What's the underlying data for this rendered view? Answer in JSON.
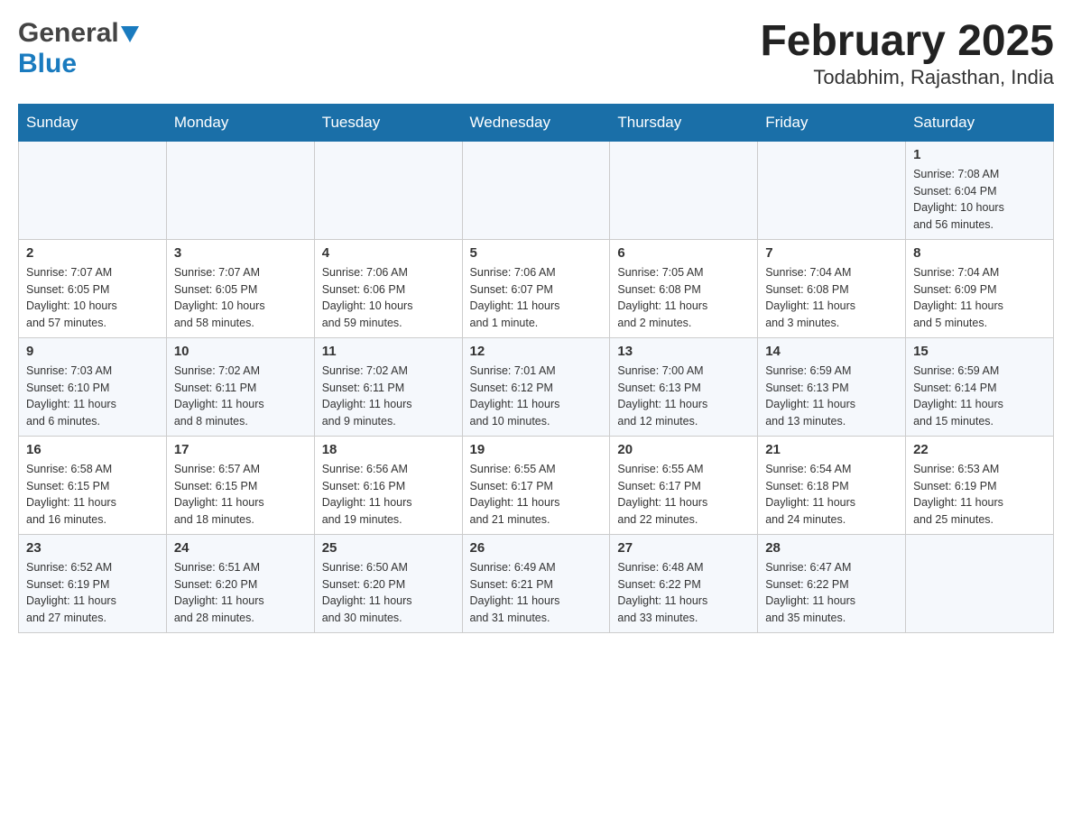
{
  "header": {
    "logo_general": "General",
    "logo_blue": "Blue",
    "title": "February 2025",
    "subtitle": "Todabhim, Rajasthan, India"
  },
  "days_of_week": [
    "Sunday",
    "Monday",
    "Tuesday",
    "Wednesday",
    "Thursday",
    "Friday",
    "Saturday"
  ],
  "weeks": [
    {
      "days": [
        {
          "number": "",
          "info": ""
        },
        {
          "number": "",
          "info": ""
        },
        {
          "number": "",
          "info": ""
        },
        {
          "number": "",
          "info": ""
        },
        {
          "number": "",
          "info": ""
        },
        {
          "number": "",
          "info": ""
        },
        {
          "number": "1",
          "info": "Sunrise: 7:08 AM\nSunset: 6:04 PM\nDaylight: 10 hours\nand 56 minutes."
        }
      ]
    },
    {
      "days": [
        {
          "number": "2",
          "info": "Sunrise: 7:07 AM\nSunset: 6:05 PM\nDaylight: 10 hours\nand 57 minutes."
        },
        {
          "number": "3",
          "info": "Sunrise: 7:07 AM\nSunset: 6:05 PM\nDaylight: 10 hours\nand 58 minutes."
        },
        {
          "number": "4",
          "info": "Sunrise: 7:06 AM\nSunset: 6:06 PM\nDaylight: 10 hours\nand 59 minutes."
        },
        {
          "number": "5",
          "info": "Sunrise: 7:06 AM\nSunset: 6:07 PM\nDaylight: 11 hours\nand 1 minute."
        },
        {
          "number": "6",
          "info": "Sunrise: 7:05 AM\nSunset: 6:08 PM\nDaylight: 11 hours\nand 2 minutes."
        },
        {
          "number": "7",
          "info": "Sunrise: 7:04 AM\nSunset: 6:08 PM\nDaylight: 11 hours\nand 3 minutes."
        },
        {
          "number": "8",
          "info": "Sunrise: 7:04 AM\nSunset: 6:09 PM\nDaylight: 11 hours\nand 5 minutes."
        }
      ]
    },
    {
      "days": [
        {
          "number": "9",
          "info": "Sunrise: 7:03 AM\nSunset: 6:10 PM\nDaylight: 11 hours\nand 6 minutes."
        },
        {
          "number": "10",
          "info": "Sunrise: 7:02 AM\nSunset: 6:11 PM\nDaylight: 11 hours\nand 8 minutes."
        },
        {
          "number": "11",
          "info": "Sunrise: 7:02 AM\nSunset: 6:11 PM\nDaylight: 11 hours\nand 9 minutes."
        },
        {
          "number": "12",
          "info": "Sunrise: 7:01 AM\nSunset: 6:12 PM\nDaylight: 11 hours\nand 10 minutes."
        },
        {
          "number": "13",
          "info": "Sunrise: 7:00 AM\nSunset: 6:13 PM\nDaylight: 11 hours\nand 12 minutes."
        },
        {
          "number": "14",
          "info": "Sunrise: 6:59 AM\nSunset: 6:13 PM\nDaylight: 11 hours\nand 13 minutes."
        },
        {
          "number": "15",
          "info": "Sunrise: 6:59 AM\nSunset: 6:14 PM\nDaylight: 11 hours\nand 15 minutes."
        }
      ]
    },
    {
      "days": [
        {
          "number": "16",
          "info": "Sunrise: 6:58 AM\nSunset: 6:15 PM\nDaylight: 11 hours\nand 16 minutes."
        },
        {
          "number": "17",
          "info": "Sunrise: 6:57 AM\nSunset: 6:15 PM\nDaylight: 11 hours\nand 18 minutes."
        },
        {
          "number": "18",
          "info": "Sunrise: 6:56 AM\nSunset: 6:16 PM\nDaylight: 11 hours\nand 19 minutes."
        },
        {
          "number": "19",
          "info": "Sunrise: 6:55 AM\nSunset: 6:17 PM\nDaylight: 11 hours\nand 21 minutes."
        },
        {
          "number": "20",
          "info": "Sunrise: 6:55 AM\nSunset: 6:17 PM\nDaylight: 11 hours\nand 22 minutes."
        },
        {
          "number": "21",
          "info": "Sunrise: 6:54 AM\nSunset: 6:18 PM\nDaylight: 11 hours\nand 24 minutes."
        },
        {
          "number": "22",
          "info": "Sunrise: 6:53 AM\nSunset: 6:19 PM\nDaylight: 11 hours\nand 25 minutes."
        }
      ]
    },
    {
      "days": [
        {
          "number": "23",
          "info": "Sunrise: 6:52 AM\nSunset: 6:19 PM\nDaylight: 11 hours\nand 27 minutes."
        },
        {
          "number": "24",
          "info": "Sunrise: 6:51 AM\nSunset: 6:20 PM\nDaylight: 11 hours\nand 28 minutes."
        },
        {
          "number": "25",
          "info": "Sunrise: 6:50 AM\nSunset: 6:20 PM\nDaylight: 11 hours\nand 30 minutes."
        },
        {
          "number": "26",
          "info": "Sunrise: 6:49 AM\nSunset: 6:21 PM\nDaylight: 11 hours\nand 31 minutes."
        },
        {
          "number": "27",
          "info": "Sunrise: 6:48 AM\nSunset: 6:22 PM\nDaylight: 11 hours\nand 33 minutes."
        },
        {
          "number": "28",
          "info": "Sunrise: 6:47 AM\nSunset: 6:22 PM\nDaylight: 11 hours\nand 35 minutes."
        },
        {
          "number": "",
          "info": ""
        }
      ]
    }
  ]
}
